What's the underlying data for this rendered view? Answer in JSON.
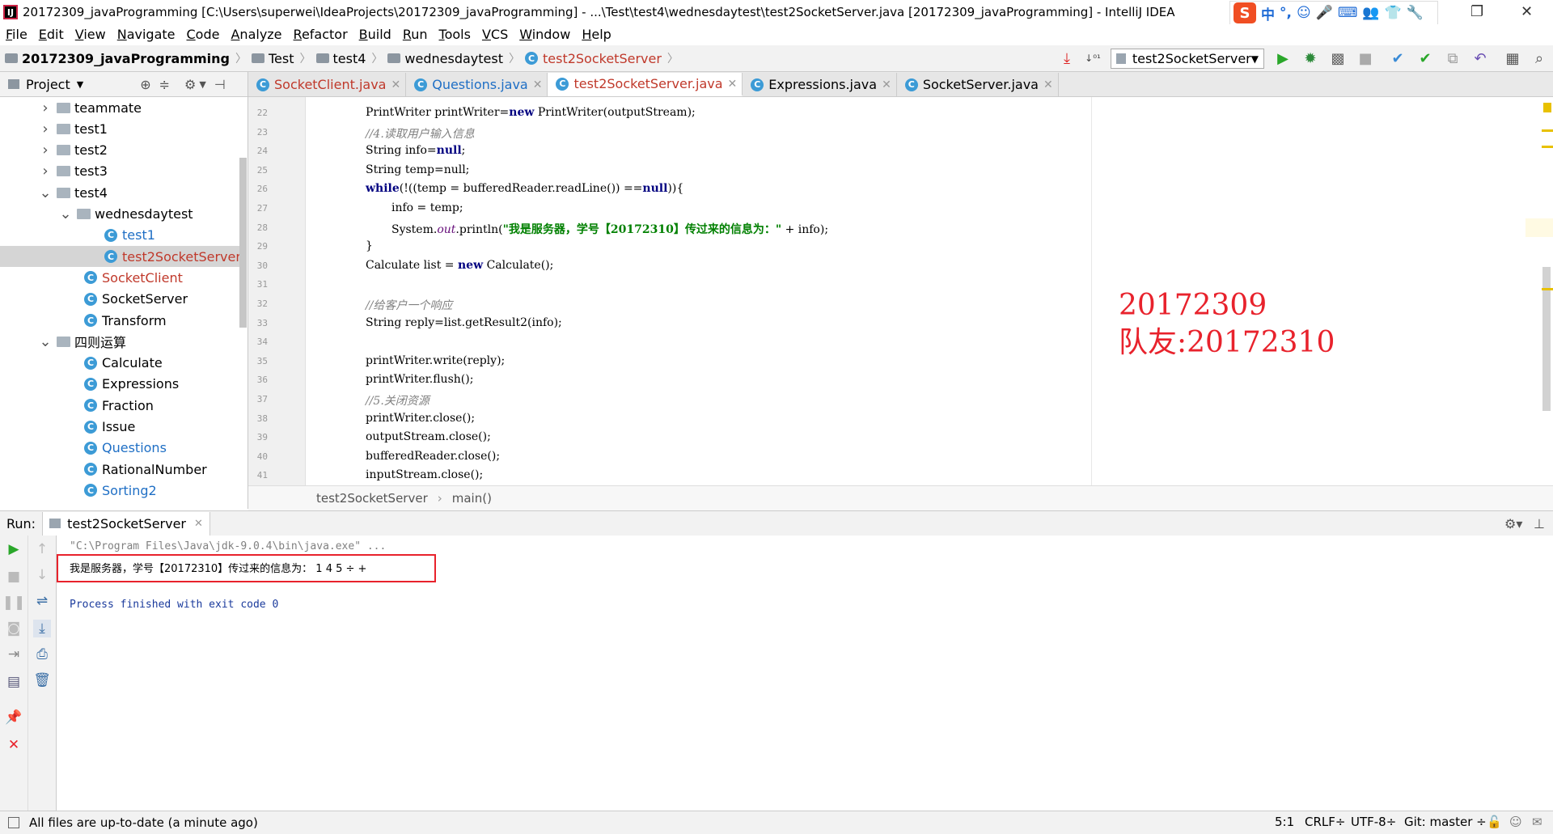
{
  "window": {
    "title": "20172309_javaProgramming [C:\\Users\\superwei\\IdeaProjects\\20172309_javaProgramming] - ...\\Test\\test4\\wednesdaytest\\test2SocketServer.java [20172309_javaProgramming] - IntelliJ IDEA",
    "app_icon": "IJ",
    "ime_logo": "S",
    "ime_mode": "中",
    "ime_punct": "°,"
  },
  "menu": [
    "File",
    "Edit",
    "View",
    "Navigate",
    "Code",
    "Analyze",
    "Refactor",
    "Build",
    "Run",
    "Tools",
    "VCS",
    "Window",
    "Help"
  ],
  "breadcrumb": [
    "20172309_javaProgramming",
    "Test",
    "test4",
    "wednesdaytest",
    "test2SocketServer"
  ],
  "run_config": "test2SocketServer",
  "project_panel": {
    "title": "Project",
    "tree": [
      {
        "label": "teammate",
        "type": "folder",
        "arrow": "right"
      },
      {
        "label": "test1",
        "type": "folder",
        "arrow": "right"
      },
      {
        "label": "test2",
        "type": "folder",
        "arrow": "right"
      },
      {
        "label": "test3",
        "type": "folder",
        "arrow": "right"
      },
      {
        "label": "test4",
        "type": "folder",
        "arrow": "down"
      },
      {
        "label": "wednesdaytest",
        "type": "folder",
        "arrow": "down"
      },
      {
        "label": "test1",
        "type": "class",
        "color": "#1f6fc5"
      },
      {
        "label": "test2SocketServer",
        "type": "class",
        "color": "#c0392b"
      },
      {
        "label": "SocketClient",
        "type": "class",
        "color": "#c0392b"
      },
      {
        "label": "SocketServer",
        "type": "class",
        "color": "#000000"
      },
      {
        "label": "Transform",
        "type": "class",
        "color": "#000000"
      },
      {
        "label": "四则运算",
        "type": "folder",
        "arrow": "down"
      },
      {
        "label": "Calculate",
        "type": "class",
        "color": "#000000"
      },
      {
        "label": "Expressions",
        "type": "class",
        "color": "#000000"
      },
      {
        "label": "Fraction",
        "type": "class",
        "color": "#000000"
      },
      {
        "label": "Issue",
        "type": "class",
        "color": "#000000"
      },
      {
        "label": "Questions",
        "type": "class",
        "color": "#1f6fc5"
      },
      {
        "label": "RationalNumber",
        "type": "class",
        "color": "#000000"
      },
      {
        "label": "Sorting2",
        "type": "class",
        "color": "#1f6fc5"
      }
    ]
  },
  "tabs": [
    {
      "label": "SocketClient.java",
      "color": "#c0392b",
      "active": false
    },
    {
      "label": "Questions.java",
      "color": "#1f6fc5",
      "active": false
    },
    {
      "label": "test2SocketServer.java",
      "color": "#c0392b",
      "active": true
    },
    {
      "label": "Expressions.java",
      "color": "#000000",
      "active": false
    },
    {
      "label": "SocketServer.java",
      "color": "#000000",
      "active": false
    }
  ],
  "code": [
    {
      "n": "22",
      "indent": 3,
      "parts": [
        [
          "PrintWriter printWriter=",
          ""
        ],
        [
          "new",
          "kw"
        ],
        [
          " PrintWriter(outputStream);",
          ""
        ]
      ]
    },
    {
      "n": "23",
      "indent": 3,
      "parts": [
        [
          "//4.读取用户输入信息",
          "cm"
        ]
      ]
    },
    {
      "n": "24",
      "indent": 3,
      "parts": [
        [
          "String info=",
          ""
        ],
        [
          "null",
          "kw"
        ],
        [
          ";",
          ""
        ]
      ]
    },
    {
      "n": "25",
      "indent": 3,
      "parts": [
        [
          "String temp=null;",
          ""
        ]
      ]
    },
    {
      "n": "26",
      "indent": 3,
      "parts": [
        [
          "while",
          "kw"
        ],
        [
          "(!((temp = bufferedReader.readLine()) ==",
          ""
        ],
        [
          "null",
          "kw"
        ],
        [
          ")){",
          ""
        ]
      ]
    },
    {
      "n": "27",
      "indent": 4,
      "parts": [
        [
          "info = temp;",
          ""
        ]
      ]
    },
    {
      "n": "28",
      "indent": 4,
      "parts": [
        [
          "System.",
          ""
        ],
        [
          "out",
          "it"
        ],
        [
          ".println(",
          ""
        ],
        [
          "\"我是服务器，学号【20172310】传过来的信息为：\"",
          "str"
        ],
        [
          " + info);",
          ""
        ]
      ]
    },
    {
      "n": "29",
      "indent": 3,
      "parts": [
        [
          "}",
          ""
        ]
      ]
    },
    {
      "n": "30",
      "indent": 3,
      "parts": [
        [
          "Calculate list = ",
          ""
        ],
        [
          "new",
          "kw"
        ],
        [
          " Calculate();",
          ""
        ]
      ]
    },
    {
      "n": "31",
      "indent": 3,
      "parts": []
    },
    {
      "n": "32",
      "indent": 3,
      "parts": [
        [
          "//给客户一个响应",
          "cm"
        ]
      ]
    },
    {
      "n": "33",
      "indent": 3,
      "parts": [
        [
          "String reply=list.getResult2(info);",
          ""
        ]
      ]
    },
    {
      "n": "34",
      "indent": 3,
      "parts": []
    },
    {
      "n": "35",
      "indent": 3,
      "parts": [
        [
          "printWriter.write(reply);",
          ""
        ]
      ]
    },
    {
      "n": "36",
      "indent": 3,
      "parts": [
        [
          "printWriter.flush();",
          ""
        ]
      ]
    },
    {
      "n": "37",
      "indent": 3,
      "parts": [
        [
          "//5.关闭资源",
          "cm"
        ]
      ]
    },
    {
      "n": "38",
      "indent": 3,
      "parts": [
        [
          "printWriter.close();",
          ""
        ]
      ]
    },
    {
      "n": "39",
      "indent": 3,
      "parts": [
        [
          "outputStream.close();",
          ""
        ]
      ]
    },
    {
      "n": "40",
      "indent": 3,
      "parts": [
        [
          "bufferedReader.close();",
          ""
        ]
      ]
    },
    {
      "n": "41",
      "indent": 3,
      "parts": [
        [
          "inputStream.close();",
          ""
        ]
      ]
    }
  ],
  "annotation": {
    "line1": "20172309",
    "line2": "队友:20172310"
  },
  "editor_breadcrumb": {
    "class": "test2SocketServer",
    "method": "main()"
  },
  "run_panel": {
    "label": "Run:",
    "tab": "test2SocketServer",
    "lines": [
      {
        "text": "\"C:\\Program Files\\Java\\jdk-9.0.4\\bin\\java.exe\" ...",
        "color": "#808080"
      },
      {
        "text": "我是服务器，学号【20172310】传过来的信息为： 1 4 5 ÷ +",
        "color": "#000000"
      },
      {
        "text": "",
        "color": "#000000"
      },
      {
        "text": "Process finished with exit code 0",
        "color": "#1a3a9c"
      }
    ]
  },
  "status": {
    "message": "All files are up-to-date (a minute ago)",
    "position": "5:1",
    "line_sep": "CRLF÷",
    "encoding": "UTF-8÷",
    "vcs": "Git: master ÷"
  },
  "colors": {
    "annotation_red": "#e8222c",
    "run_green": "#2aa72a",
    "stop_red": "#e8222c"
  }
}
